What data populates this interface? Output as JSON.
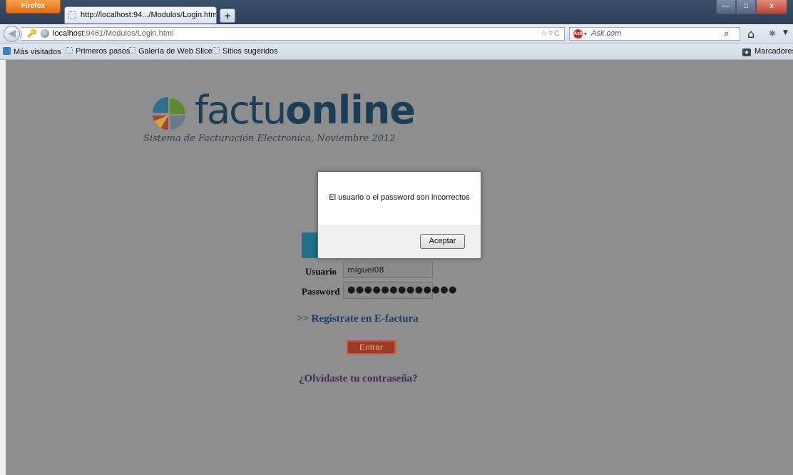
{
  "browser": {
    "menu_button_label": "Firefox",
    "tab_title": "http://localhost:94.../Modulos/Login.html",
    "new_tab_label": "+",
    "window_controls": {
      "minimize": "—",
      "maximize": "□",
      "close": "x"
    },
    "url": {
      "host": "localhost",
      "rest": ":9461/Modulos/Login.html"
    },
    "search_placeholder": "Ask.com",
    "bookmarks": [
      "Más visitados",
      "Primeros pasos",
      "Galería de Web Slice",
      "Sitios sugeridos"
    ],
    "bookmarks_menu_label": "Marcadores"
  },
  "page": {
    "logo_light": "factu",
    "logo_bold": "online",
    "subtitle": "Sistema de Facturación Electronica, Noviembre 2012",
    "usuario_label": "Usuario",
    "usuario_value": "miguel08",
    "password_label": "Password",
    "password_value": "●●●●●●●●●●●●●",
    "register_prefix": ">>",
    "register_text": "Registrate en E-factura",
    "entrar_label": "Entrar",
    "forgot_text": "¿Olvidaste tu contraseña?"
  },
  "dialog": {
    "message": "El usuario o el password son incorrectos",
    "button_label": "Aceptar"
  },
  "colors": {
    "page_overlay": "#8e8e8e",
    "brand_dark": "#1b3e58",
    "banner_teal": "#1f6f86",
    "entrar_bg": "#9b3a28",
    "firefox_orange": "#e46b12"
  },
  "icons": [
    "key-icon",
    "globe-icon",
    "star-icon",
    "reload-icon",
    "ask-icon",
    "search-icon",
    "home-icon",
    "addon-icon",
    "back-icon"
  ]
}
